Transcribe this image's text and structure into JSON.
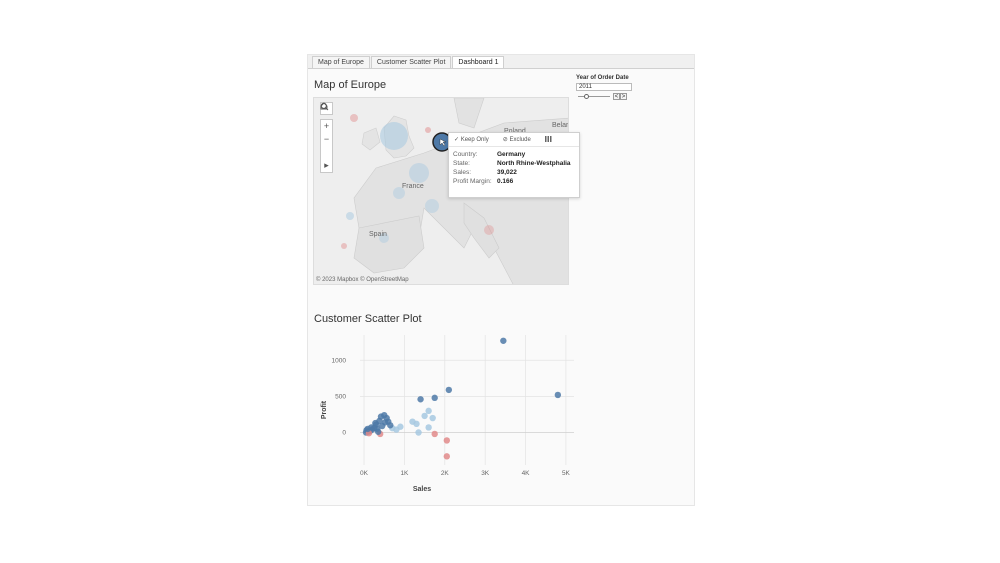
{
  "tabs": [
    {
      "label": "Map of Europe",
      "active": false
    },
    {
      "label": "Customer Scatter Plot",
      "active": false
    },
    {
      "label": "Dashboard 1",
      "active": true
    }
  ],
  "map": {
    "title": "Map of Europe",
    "labels": {
      "france": "France",
      "spain": "Spain",
      "poland": "Poland",
      "belarus": "Belar"
    },
    "attribution": "© 2023 Mapbox © OpenStreetMap",
    "tools": {
      "search": "search-icon",
      "zoom_in": "+",
      "zoom_out": "−",
      "home": "home-icon",
      "more": "▸"
    }
  },
  "filter": {
    "label": "Year of Order Date",
    "value": "2011",
    "prev": "<",
    "next": ">"
  },
  "tooltip": {
    "keep_only": "Keep Only",
    "exclude": "Exclude",
    "rows": [
      {
        "key": "Country:",
        "value": "Germany"
      },
      {
        "key": "State:",
        "value": "North Rhine-Westphalia"
      },
      {
        "key": "Sales:",
        "value": "39,022"
      },
      {
        "key": "Profit Margin:",
        "value": "0.166"
      }
    ]
  },
  "scatter": {
    "title": "Customer Scatter Plot"
  },
  "colors": {
    "positive_dark": "#4e79a7",
    "positive_light": "#a6c8e0",
    "negative": "#e08a8a"
  },
  "chart_data": {
    "type": "scatter",
    "title": "Customer Scatter Plot",
    "xlabel": "Sales",
    "ylabel": "Profit",
    "xlim": [
      -100,
      5200
    ],
    "ylim": [
      -450,
      1350
    ],
    "xticks": [
      {
        "v": 0,
        "label": "0K"
      },
      {
        "v": 1000,
        "label": "1K"
      },
      {
        "v": 2000,
        "label": "2K"
      },
      {
        "v": 3000,
        "label": "3K"
      },
      {
        "v": 4000,
        "label": "4K"
      },
      {
        "v": 5000,
        "label": "5K"
      }
    ],
    "yticks": [
      {
        "v": 0,
        "label": "0"
      },
      {
        "v": 500,
        "label": "500"
      },
      {
        "v": 1000,
        "label": "1000"
      }
    ],
    "grid": true,
    "points": [
      {
        "x": 3450,
        "y": 1270
      },
      {
        "x": 4800,
        "y": 520
      },
      {
        "x": 2100,
        "y": 590
      },
      {
        "x": 1750,
        "y": 480
      },
      {
        "x": 1400,
        "y": 460
      },
      {
        "x": 1500,
        "y": 230
      },
      {
        "x": 1600,
        "y": 300
      },
      {
        "x": 1700,
        "y": 200
      },
      {
        "x": 1200,
        "y": 150
      },
      {
        "x": 1300,
        "y": 120
      },
      {
        "x": 1600,
        "y": 70
      },
      {
        "x": 1350,
        "y": 0
      },
      {
        "x": 2050,
        "y": -110
      },
      {
        "x": 2050,
        "y": -330
      },
      {
        "x": 1750,
        "y": -20
      },
      {
        "x": 900,
        "y": 80
      },
      {
        "x": 500,
        "y": 240
      },
      {
        "x": 420,
        "y": 220
      },
      {
        "x": 560,
        "y": 200
      },
      {
        "x": 600,
        "y": 150
      },
      {
        "x": 380,
        "y": 160
      },
      {
        "x": 300,
        "y": 110
      },
      {
        "x": 450,
        "y": 90
      },
      {
        "x": 250,
        "y": 60
      },
      {
        "x": 200,
        "y": 40
      },
      {
        "x": 150,
        "y": 20
      },
      {
        "x": 100,
        "y": 10
      },
      {
        "x": 50,
        "y": 0
      },
      {
        "x": 60,
        "y": 30
      },
      {
        "x": 180,
        "y": 70
      },
      {
        "x": 330,
        "y": 50
      },
      {
        "x": 700,
        "y": 60
      },
      {
        "x": 800,
        "y": 40
      },
      {
        "x": 400,
        "y": -20
      },
      {
        "x": 120,
        "y": -10
      },
      {
        "x": 650,
        "y": 100
      },
      {
        "x": 520,
        "y": 140
      },
      {
        "x": 280,
        "y": 130
      },
      {
        "x": 350,
        "y": 10
      },
      {
        "x": 90,
        "y": 50
      }
    ]
  }
}
